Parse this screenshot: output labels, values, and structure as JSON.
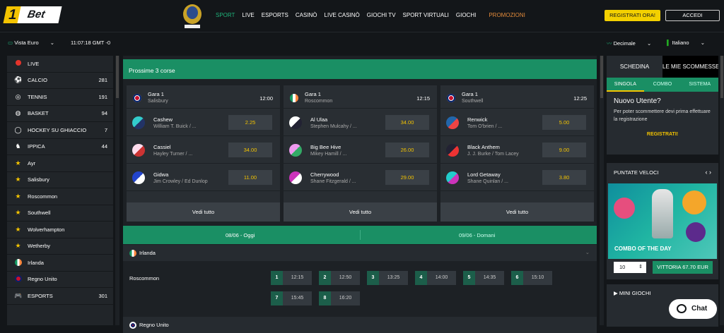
{
  "header": {
    "logo_one": "1",
    "logo_bet": "Bet",
    "nav": [
      "SPORT",
      "LIVE",
      "ESPORTS",
      "CASINÒ",
      "LIVE CASINÒ",
      "GIOCHI TV",
      "SPORT VIRTUALI",
      "GIOCHI"
    ],
    "promo": "PROMOZIONI",
    "register": "REGISTRATI ORA!",
    "login": "ACCEDI"
  },
  "subbar": {
    "vista": "Vista Euro",
    "time": "11:07:18 GMT -0",
    "odds_format": "Decimale",
    "language": "Italiano"
  },
  "sidebar": [
    {
      "label": "LIVE",
      "count": "",
      "icon": "live-dot-icon"
    },
    {
      "label": "CALCIO",
      "count": "281",
      "icon": "football-icon"
    },
    {
      "label": "TENNIS",
      "count": "191",
      "icon": "tennis-icon"
    },
    {
      "label": "BASKET",
      "count": "94",
      "icon": "basketball-icon"
    },
    {
      "label": "HOCKEY SU GHIACCIO",
      "count": "7",
      "icon": "hockey-icon"
    },
    {
      "label": "IPPICA",
      "count": "44",
      "icon": "horse-icon"
    },
    {
      "label": "Ayr",
      "count": "",
      "icon": "star-icon"
    },
    {
      "label": "Salisbury",
      "count": "",
      "icon": "star-icon"
    },
    {
      "label": "Roscommon",
      "count": "",
      "icon": "star-icon"
    },
    {
      "label": "Southwell",
      "count": "",
      "icon": "star-icon"
    },
    {
      "label": "Wolverhampton",
      "count": "",
      "icon": "star-icon"
    },
    {
      "label": "Wetherby",
      "count": "",
      "icon": "star-icon"
    },
    {
      "label": "Irlanda",
      "count": "",
      "icon": "ireland-flag-icon"
    },
    {
      "label": "Regno Unito",
      "count": "",
      "icon": "uk-flag-icon"
    },
    {
      "label": "ESPORTS",
      "count": "301",
      "icon": "gamepad-icon"
    }
  ],
  "main": {
    "banner": "Prossime 3 corse",
    "races": [
      {
        "title": "Gara 1",
        "venue": "Salisbury",
        "time": "12:00",
        "flag": "uk",
        "runners": [
          {
            "name": "Cashew",
            "jockey": "William T. Buick / ...",
            "odd": "2.25"
          },
          {
            "name": "Cassiel",
            "jockey": "Hayley Turner / ...",
            "odd": "34.00"
          },
          {
            "name": "Gidwa",
            "jockey": "Jim Crowley / Ed Dunlop",
            "odd": "11.00"
          }
        ]
      },
      {
        "title": "Gara 1",
        "venue": "Roscommon",
        "time": "12:15",
        "flag": "ie",
        "runners": [
          {
            "name": "Al Ulaa",
            "jockey": "Stephen Mulcahy / ...",
            "odd": "34.00"
          },
          {
            "name": "Big Bee Hive",
            "jockey": "Mikey Hamill / ...",
            "odd": "26.00"
          },
          {
            "name": "Cherrywood",
            "jockey": "Shane Fitzgerald / ...",
            "odd": "29.00"
          }
        ]
      },
      {
        "title": "Gara 1",
        "venue": "Southwell",
        "time": "12:25",
        "flag": "uk",
        "runners": [
          {
            "name": "Renwick",
            "jockey": "Tom O'brien / ...",
            "odd": "5.00"
          },
          {
            "name": "Black Anthem",
            "jockey": "J. J. Burke / Tom Lacey",
            "odd": "9.00"
          },
          {
            "name": "Lord Getaway",
            "jockey": "Shane Quinlan / ...",
            "odd": "3.80"
          }
        ]
      }
    ],
    "see_all": "Vedi tutto",
    "date_today": "08/06 - Oggi",
    "date_tomorrow": "09/06 - Domani",
    "country1": "Irlanda",
    "venue": "Roscommon",
    "slots": [
      {
        "n": "1",
        "t": "12:15"
      },
      {
        "n": "2",
        "t": "12:50"
      },
      {
        "n": "3",
        "t": "13:25"
      },
      {
        "n": "4",
        "t": "14:00"
      },
      {
        "n": "5",
        "t": "14:35"
      },
      {
        "n": "6",
        "t": "15:10"
      },
      {
        "n": "7",
        "t": "15:45"
      },
      {
        "n": "8",
        "t": "16:20"
      }
    ],
    "country2": "Regno Unito"
  },
  "right": {
    "tab_schedina": "SCHEDINA",
    "tab_scommesse": "LE MIE SCOMMESSE",
    "subtabs": [
      "SINGOLA",
      "COMBO",
      "SISTEMA"
    ],
    "new_user": "Nuovo Utente?",
    "new_user_text": "Per poter scommettere devi prima effettuare la registrazione",
    "register_link": "REGISTRATI!",
    "quick_bets": "PUNTATE VELOCI",
    "combo": "COMBO OF THE DAY",
    "stake": "10",
    "win": "VITTORIA 67.70 EUR",
    "mini_games": "MINI GIOCHI"
  },
  "chat": "Chat"
}
